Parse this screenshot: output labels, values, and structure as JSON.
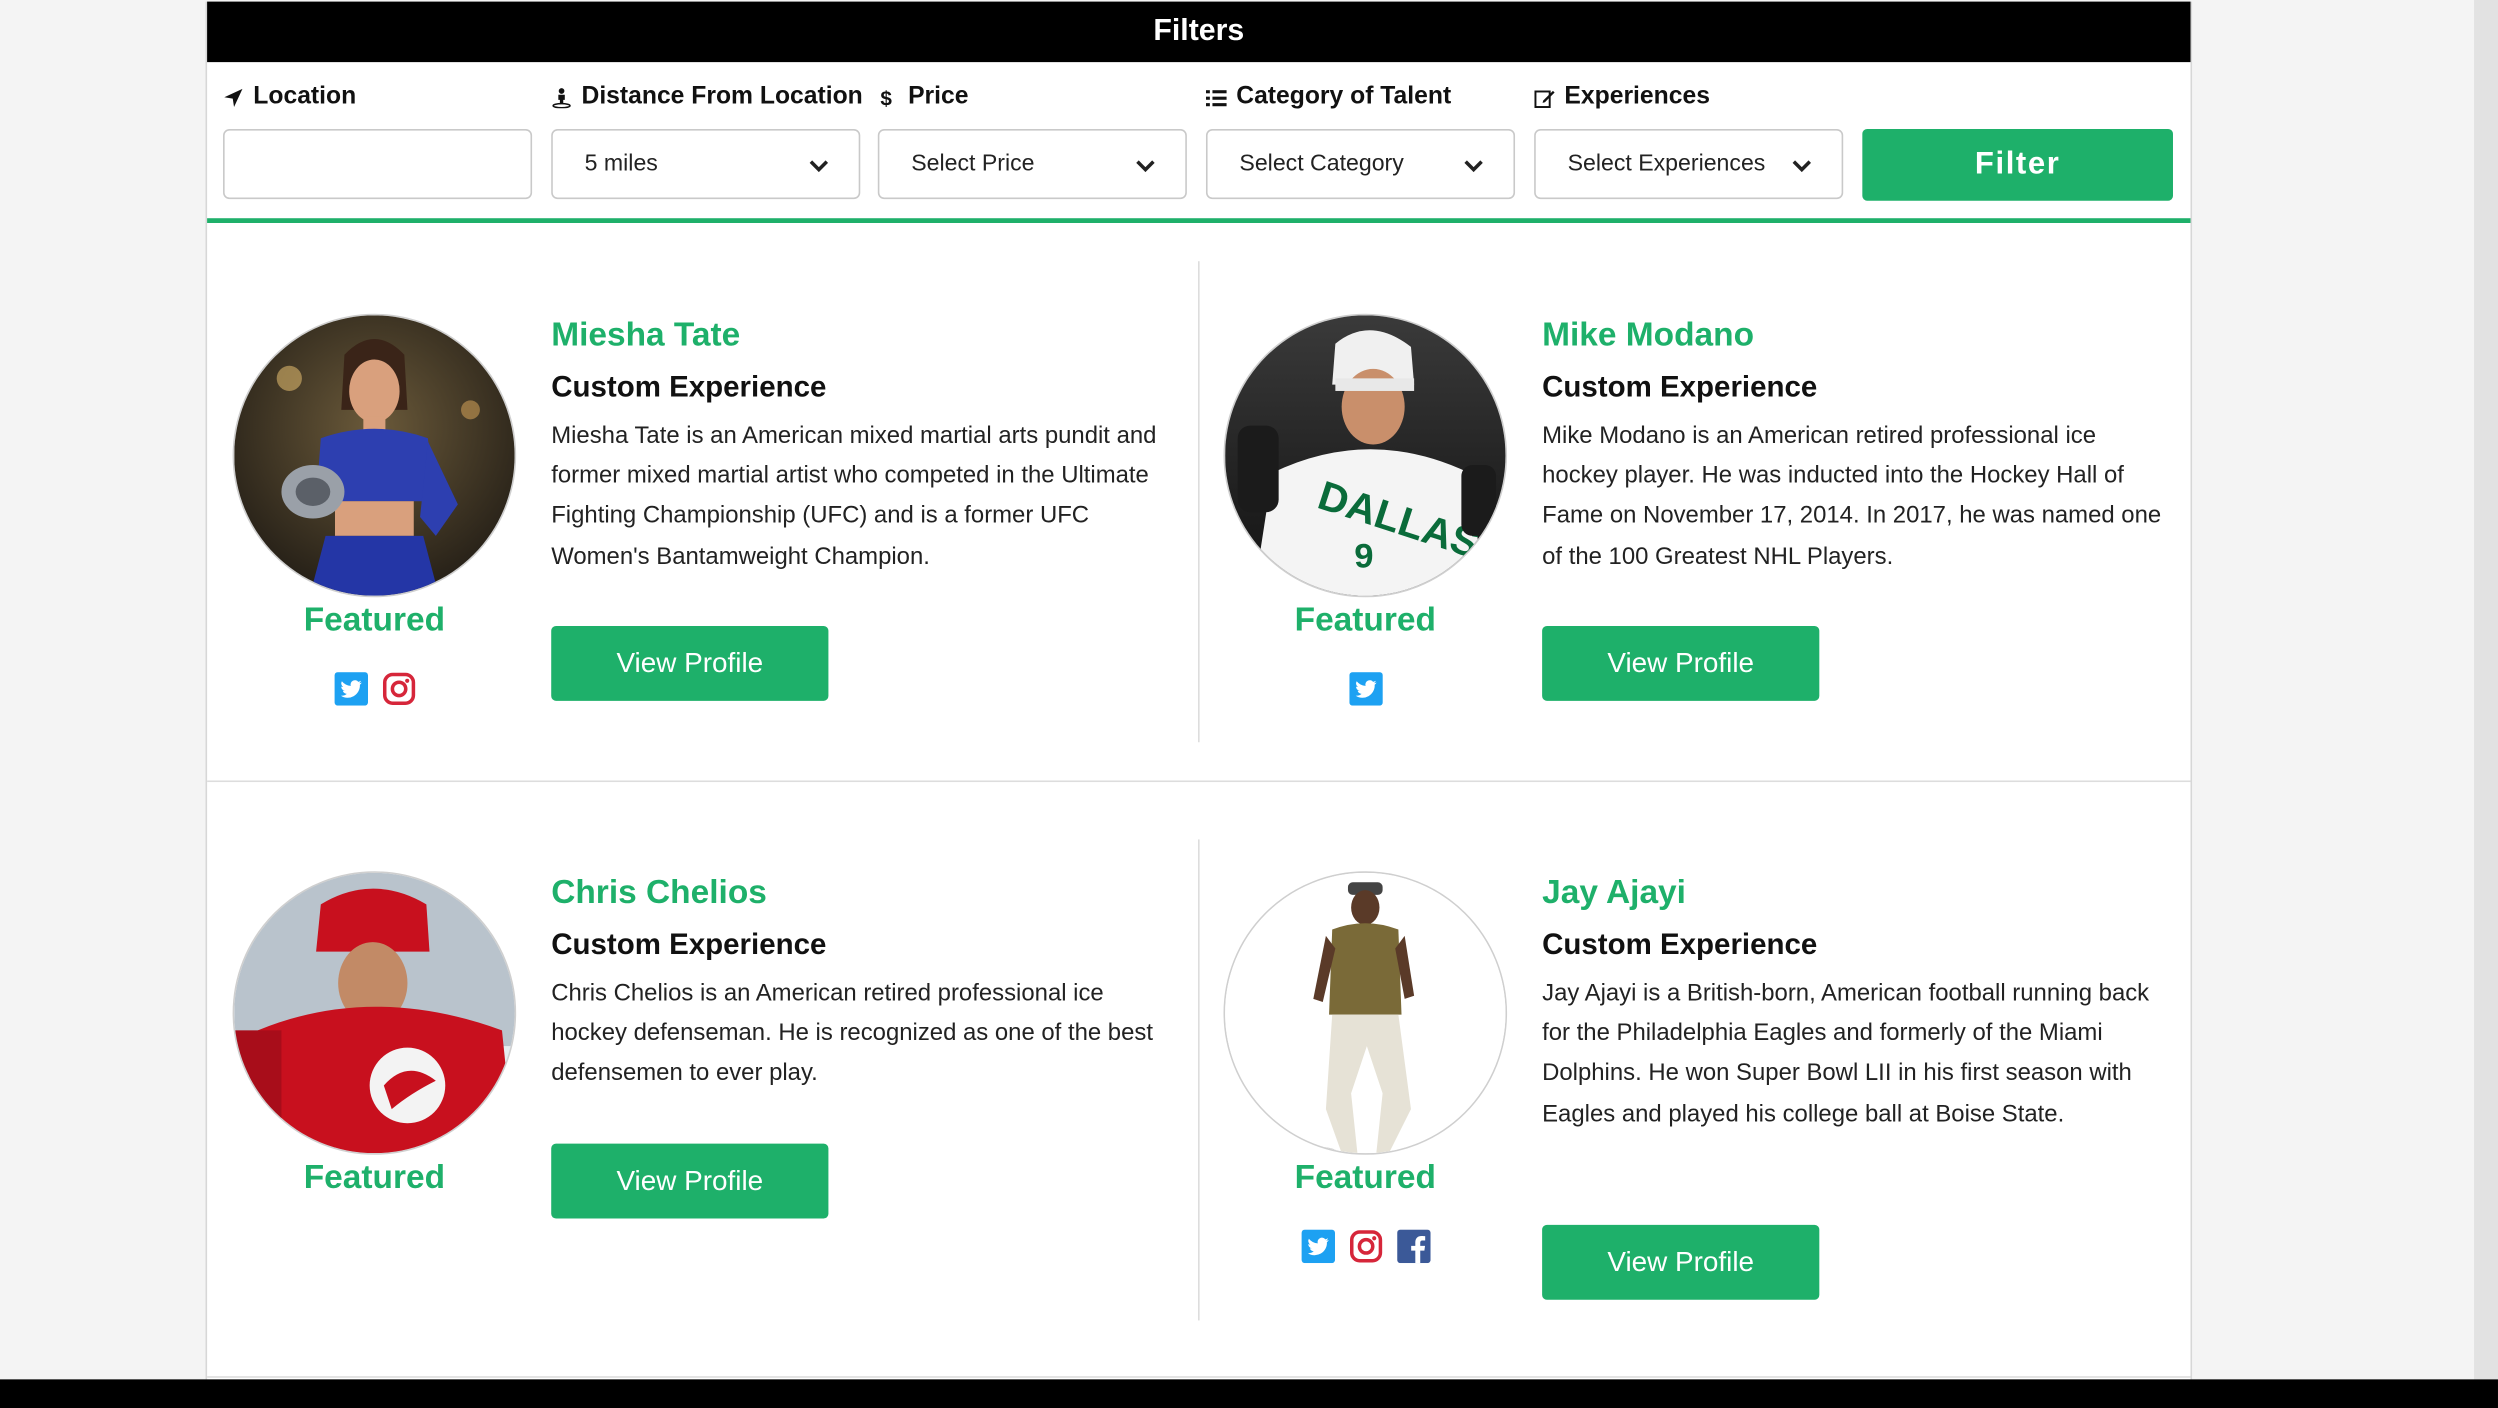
{
  "filters": {
    "title": "Filters",
    "location_label": "Location",
    "location_value": "",
    "distance_label": "Distance From Location",
    "distance_value": "5 miles",
    "price_label": "Price",
    "price_value": "Select Price",
    "category_label": "Category of Talent",
    "category_value": "Select Category",
    "experiences_label": "Experiences",
    "experiences_value": "Select Experiences",
    "filter_button": "Filter"
  },
  "colors": {
    "accent_green": "#1eb06a",
    "header_black": "#000000",
    "twitter_blue": "#1da1f2",
    "instagram_red": "#d6263a",
    "facebook_blue": "#3b5998"
  },
  "talents": [
    {
      "name": "Miesha Tate",
      "subtitle": "Custom Experience",
      "description": "Miesha Tate is an American mixed martial arts pundit and former mixed martial artist who competed in the Ultimate Fighting Championship (UFC) and is a former UFC Women's Bantamweight Champion.",
      "featured_label": "Featured",
      "button_label": "View Profile",
      "socials": [
        "twitter-icon",
        "instagram-icon"
      ]
    },
    {
      "name": "Mike Modano",
      "subtitle": "Custom Experience",
      "description": "Mike Modano is an American retired professional ice hockey player. He was inducted into the Hockey Hall of Fame on November 17, 2014. In 2017, he was named one of the 100 Greatest NHL Players.",
      "featured_label": "Featured",
      "button_label": "View Profile",
      "socials": [
        "twitter-icon"
      ]
    },
    {
      "name": "Chris Chelios",
      "subtitle": "Custom Experience",
      "description": "Chris Chelios is an American retired professional ice hockey defenseman. He is recognized as one of the best defensemen to ever play.",
      "featured_label": "Featured",
      "button_label": "View Profile",
      "socials": []
    },
    {
      "name": "Jay Ajayi",
      "subtitle": "Custom Experience",
      "description": "Jay Ajayi is a British-born, American football running back for the Philadelphia Eagles and formerly of the Miami Dolphins. He won Super Bowl LII in his first season with Eagles and played his college ball at Boise State.",
      "featured_label": "Featured",
      "button_label": "View Profile",
      "socials": [
        "twitter-icon",
        "instagram-icon",
        "facebook-icon"
      ]
    }
  ]
}
